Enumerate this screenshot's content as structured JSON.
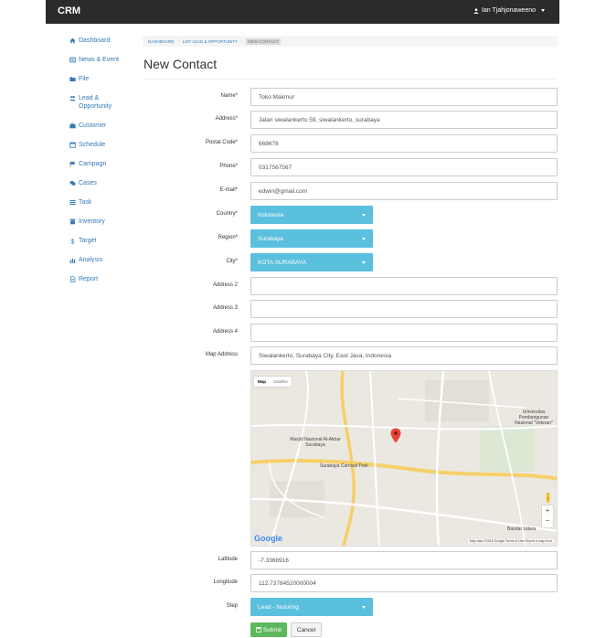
{
  "app": {
    "brand": "CRM",
    "user_name": "Ian Tjahjonaweeno"
  },
  "sidebar": {
    "items": [
      {
        "label": "Dashboard",
        "icon": "home-icon"
      },
      {
        "label": "News & Event",
        "icon": "newspaper-icon"
      },
      {
        "label": "File",
        "icon": "folder-icon"
      },
      {
        "label": "Lead & Opportunity",
        "icon": "users-icon"
      },
      {
        "label": "Customer",
        "icon": "briefcase-icon"
      },
      {
        "label": "Schedule",
        "icon": "calendar-icon"
      },
      {
        "label": "Campagn",
        "icon": "flag-icon"
      },
      {
        "label": "Cases",
        "icon": "comments-icon"
      },
      {
        "label": "Task",
        "icon": "list-icon"
      },
      {
        "label": "Inventory",
        "icon": "archive-icon"
      },
      {
        "label": "Target",
        "icon": "dollar-icon"
      },
      {
        "label": "Analysis",
        "icon": "bar-chart-icon"
      },
      {
        "label": "Report",
        "icon": "file-icon"
      }
    ]
  },
  "breadcrumb": {
    "home": "DASHBOARD",
    "parent": "LIST LEAD & OPPORTUNITY",
    "current": "NEW CONTACT"
  },
  "page": {
    "title": "New Contact"
  },
  "form": {
    "name": {
      "label": "Name*",
      "value": "Toko Makmur"
    },
    "address": {
      "label": "Address*",
      "value": "Jalan siwalankerto 59, siwalankerto, surabaya"
    },
    "postal_code": {
      "label": "Postal Code*",
      "value": "668678"
    },
    "phone": {
      "label": "Phone*",
      "value": "0317567567"
    },
    "email": {
      "label": "E-mail*",
      "value": "edwin@gmail.com"
    },
    "country": {
      "label": "Country*",
      "value": "Indonesia"
    },
    "region": {
      "label": "Region*",
      "value": "Surabaya"
    },
    "city": {
      "label": "City*",
      "value": "KOTA SURABAYA"
    },
    "address2": {
      "label": "Address 2",
      "value": ""
    },
    "address3": {
      "label": "Address 3",
      "value": ""
    },
    "address4": {
      "label": "Address 4",
      "value": ""
    },
    "map_address": {
      "label": "Map Address",
      "value": "Siwalankerto, Surabaya City, East Java, Indonesia"
    },
    "latitude": {
      "label": "Latitude",
      "value": "-7.3368916"
    },
    "longitude": {
      "label": "Longitude",
      "value": "112.73784520000004"
    },
    "step": {
      "label": "Step",
      "value": "Lead - Nuturing"
    },
    "submit_label": "Submit",
    "cancel_label": "Cancel"
  },
  "map": {
    "type_map": "Map",
    "type_satellite": "Satellite",
    "labels": {
      "univ": "Universitas Pembangunan Nasional \"Veteran\"",
      "masjid": "Masjid Nasional Al-Akbar Surabaya",
      "carpool": "Surabaya Carnival Park",
      "bandara": "Bandar Udara"
    },
    "logo": "Google",
    "footer": "Map data ©2016 Google   Terms of Use   Report a map error",
    "zoom_in": "+",
    "zoom_out": "−"
  },
  "colors": {
    "accent": "#5bc0de",
    "link": "#337ab7",
    "success": "#5cb85c",
    "topbar": "#2b2b2b"
  }
}
